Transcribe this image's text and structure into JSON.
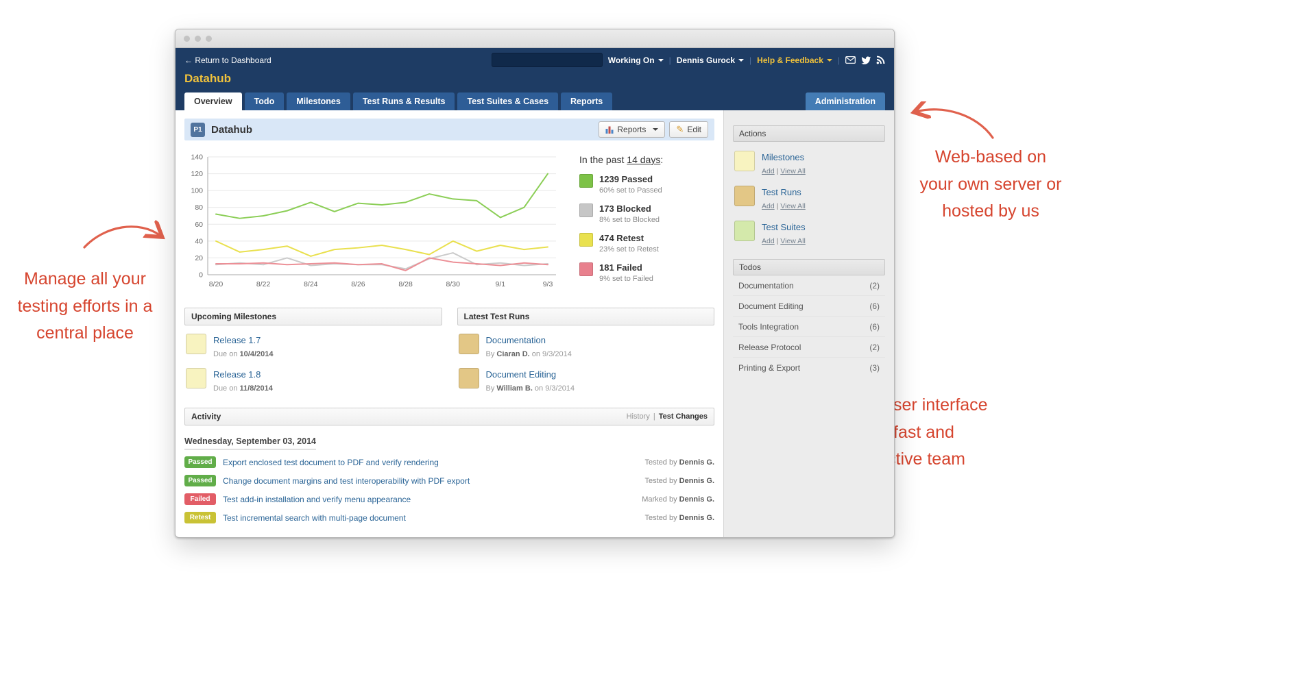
{
  "annotations": {
    "left_text": "Manage all your testing efforts in a central place",
    "top_right_text": "Web-based on your own server or hosted by us",
    "bottom_right_text": "Modern user interface for a fast and productive team",
    "color": "#d6452f",
    "arrow_color": "#e0614d"
  },
  "window": {
    "topbar": {
      "return_link": "← Return to Dashboard",
      "working_on": "Working On",
      "user_menu": "Dennis Gurock",
      "help_menu": "Help & Feedback",
      "separator": "|"
    },
    "brand": "Datahub",
    "tabs": [
      {
        "label": "Overview"
      },
      {
        "label": "Todo"
      },
      {
        "label": "Milestones"
      },
      {
        "label": "Test Runs & Results"
      },
      {
        "label": "Test Suites & Cases"
      },
      {
        "label": "Reports"
      }
    ],
    "admin_tab": "Administration"
  },
  "page_header": {
    "badge": "P1",
    "title": "Datahub",
    "reports_button": "Reports",
    "edit_button": "Edit"
  },
  "summary": {
    "title_prefix": "In the past ",
    "title_range": "14 days",
    "title_suffix": ":",
    "entries": [
      {
        "count": "1239 Passed",
        "detail": "60% set to Passed",
        "color": "#7dc247"
      },
      {
        "count": "173 Blocked",
        "detail": "8% set to Blocked",
        "color": "#c6c6c6"
      },
      {
        "count": "474 Retest",
        "detail": "23% set to Retest",
        "color": "#e9e14f"
      },
      {
        "count": "181 Failed",
        "detail": "9% set to Failed",
        "color": "#e8808d"
      }
    ]
  },
  "chart_data": {
    "type": "line",
    "x": [
      "8/20",
      "8/21",
      "8/22",
      "8/23",
      "8/24",
      "8/25",
      "8/26",
      "8/27",
      "8/28",
      "8/29",
      "8/30",
      "8/31",
      "9/1",
      "9/2",
      "9/3"
    ],
    "x_tick_every": 2,
    "ylim": [
      0,
      140
    ],
    "y_ticks": [
      0,
      20,
      40,
      60,
      80,
      100,
      120,
      140
    ],
    "grid": true,
    "legend_position": "right",
    "series": [
      {
        "name": "Blocked",
        "color": "#cbcbcb",
        "values": [
          12,
          14,
          12,
          20,
          11,
          13,
          12,
          12,
          7,
          19,
          26,
          12,
          14,
          11,
          13
        ]
      },
      {
        "name": "Failed",
        "color": "#ec8f96",
        "values": [
          13,
          13,
          14,
          12,
          13,
          14,
          12,
          13,
          5,
          20,
          15,
          13,
          11,
          14,
          12
        ]
      },
      {
        "name": "Retest",
        "color": "#e9e04e",
        "values": [
          40,
          27,
          30,
          34,
          22,
          30,
          32,
          35,
          30,
          24,
          40,
          28,
          35,
          30,
          33
        ]
      },
      {
        "name": "Passed",
        "color": "#8bce56",
        "values": [
          72,
          67,
          70,
          76,
          86,
          75,
          85,
          83,
          86,
          96,
          90,
          88,
          68,
          80,
          120
        ]
      }
    ]
  },
  "milestones_panel": {
    "title": "Upcoming Milestones",
    "icon_color": "#f8f3c0",
    "items": [
      {
        "name": "Release 1.7",
        "due_prefix": "Due on ",
        "due_date": "10/4/2014"
      },
      {
        "name": "Release 1.8",
        "due_prefix": "Due on ",
        "due_date": "11/8/2014"
      }
    ]
  },
  "test_runs_panel": {
    "title": "Latest Test Runs",
    "icon_color": "#e3c786",
    "items": [
      {
        "name": "Documentation",
        "by_prefix": "By ",
        "by_name": "Ciaran D.",
        "by_suffix": " on 9/3/2014"
      },
      {
        "name": "Document Editing",
        "by_prefix": "By ",
        "by_name": "William B.",
        "by_suffix": " on 9/3/2014"
      }
    ]
  },
  "activity": {
    "title": "Activity",
    "history_link": "History",
    "separator": "|",
    "test_changes_link": "Test Changes",
    "date_heading": "Wednesday, September 03, 2014",
    "rows": [
      {
        "badge": "Passed",
        "badge_color": "#61ad49",
        "text": "Export enclosed test document to PDF and verify rendering",
        "by_prefix": "Tested by ",
        "by_name": "Dennis G."
      },
      {
        "badge": "Passed",
        "badge_color": "#61ad49",
        "text": "Change document margins and test interoperability with PDF export",
        "by_prefix": "Tested by ",
        "by_name": "Dennis G."
      },
      {
        "badge": "Failed",
        "badge_color": "#e25d66",
        "text": "Test add-in installation and verify menu appearance",
        "by_prefix": "Marked by ",
        "by_name": "Dennis G."
      },
      {
        "badge": "Retest",
        "badge_color": "#c9c235",
        "text": "Test incremental search with multi-page document",
        "by_prefix": "Tested by ",
        "by_name": "Dennis G."
      }
    ]
  },
  "sidebar": {
    "actions_title": "Actions",
    "link_separator": "|",
    "actions": [
      {
        "label": "Milestones",
        "add": "Add",
        "view_all": "View All",
        "color": "#f8f3c0"
      },
      {
        "label": "Test Runs",
        "add": "Add",
        "view_all": "View All",
        "color": "#e3c786"
      },
      {
        "label": "Test Suites",
        "add": "Add",
        "view_all": "View All",
        "color": "#d4e9ab"
      }
    ],
    "todos_title": "Todos",
    "todos": [
      {
        "label": "Documentation",
        "count": "(2)"
      },
      {
        "label": "Document Editing",
        "count": "(6)"
      },
      {
        "label": "Tools Integration",
        "count": "(6)"
      },
      {
        "label": "Release Protocol",
        "count": "(2)"
      },
      {
        "label": "Printing & Export",
        "count": "(3)"
      }
    ]
  },
  "colors": {
    "navy_header": "#1e3c64",
    "tab_blue": "#2e5d96",
    "admin_tab_blue": "#447cb5",
    "brand_yellow": "#f0c23c",
    "page_header_blue": "#d9e7f7",
    "link_blue": "#2a6496",
    "sidebar_gray": "#ececec"
  }
}
